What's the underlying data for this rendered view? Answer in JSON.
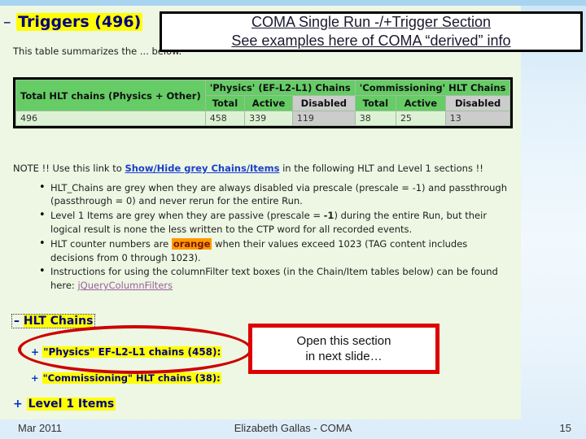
{
  "slide": {
    "section_heading": {
      "toggle": "–",
      "label": "Triggers (496)"
    },
    "intro_text": "This table summarizes the ... below."
  },
  "title_callout": {
    "line1": "COMA Single Run  -/+Trigger Section",
    "line2": "See examples here of COMA “derived” info"
  },
  "summary_table": {
    "group_headers": {
      "total_hlt": "Total HLT chains (Physics + Other)",
      "physics": "'Physics' (EF-L2-L1) Chains",
      "commissioning": "'Commissioning' HLT Chains"
    },
    "sub_headers": {
      "physics_total": "Total",
      "physics_active": "Active",
      "physics_disabled": "Disabled",
      "comm_total": "Total",
      "comm_active": "Active",
      "comm_disabled": "Disabled"
    },
    "values": {
      "total_hlt": "496",
      "physics_total": "458",
      "physics_active": "339",
      "physics_disabled": "119",
      "comm_total": "38",
      "comm_active": "25",
      "comm_disabled": "13"
    }
  },
  "note": {
    "prefix": "NOTE !! Use this link to ",
    "link": "Show/Hide grey Chains/Items",
    "suffix": " in the following HLT and Level 1 sections !!",
    "bullets": [
      {
        "id": "bullet-hlt-chains-grey",
        "text_before": "HLT_Chains are grey when they are always disabled via prescale (prescale = -1) and passthrough (passthrough = 0) and never rerun for the entire Run."
      },
      {
        "id": "bullet-level1-grey",
        "text_before": "Level 1 Items are grey when they are passive (prescale = ",
        "bold": "-1",
        "text_after": ") during the entire Run, but their logical result is none the less written to the CTP word for all recorded events."
      },
      {
        "id": "bullet-counter-orange",
        "text_before": "HLT counter numbers are ",
        "highlight": "orange",
        "text_after": " when their values exceed 1023 (TAG content includes decisions from 0 through 1023)."
      },
      {
        "id": "bullet-columnfilter",
        "text_before": "Instructions for using the columnFilter text boxes (in the Chain/Item tables below) can be found here: ",
        "link": "jQueryColumnFilters"
      }
    ]
  },
  "hlt_section": {
    "heading_toggle": "–",
    "heading": "HLT Chains",
    "items": [
      {
        "toggle": "+",
        "label": "\"Physics\" EF-L2-L1 chains (458):"
      },
      {
        "toggle": "+",
        "label": "\"Commissioning\" HLT chains (38):"
      }
    ],
    "level1": {
      "toggle": "+",
      "label": "Level 1 Items"
    }
  },
  "open_callout": {
    "line1": "Open this section",
    "line2": "in next slide…"
  },
  "footer": {
    "date": "Mar 2011",
    "center": "Elizabeth Gallas - COMA",
    "page": "15"
  },
  "colors": {
    "highlight_yellow": "#ffff00",
    "header_green": "#66cc66",
    "header_grey": "#cccccc",
    "cell_green": "#ddf2d4",
    "orange": "#ff9900",
    "callout_red": "#dd0000",
    "link_blue": "#1a3ecc",
    "link_purple": "#9b5fa0",
    "heading_navy": "#000080"
  }
}
